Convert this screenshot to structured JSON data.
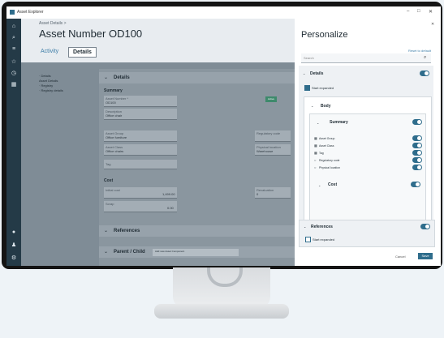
{
  "window": {
    "title": "Asset Explorer",
    "min": "–",
    "max": "□",
    "close": "✕"
  },
  "nav_icons": [
    "home-icon",
    "search-icon",
    "list-icon",
    "star-icon",
    "history-icon",
    "grid-icon",
    "info-icon",
    "user-icon",
    "settings-icon"
  ],
  "header": {
    "breadcrumb": "Asset Details  >",
    "title": "Asset Number OD100",
    "tab_activity": "Activity",
    "tab_details": "Details"
  },
  "tree": [
    "· Details",
    "   Asset Details",
    "· Registry",
    "   · Registry details"
  ],
  "details": {
    "section_title": "Details",
    "summary_label": "Summary",
    "status_badge": "Active",
    "fields": [
      {
        "label": "Asset Number *",
        "value": "OD100"
      },
      {
        "label": "Description",
        "value": "Office chair"
      },
      {
        "label": "Asset Group",
        "value": "Office furniture"
      },
      {
        "label": "Asset Class",
        "value": "Office chairs"
      },
      {
        "label": "Tag",
        "value": ""
      },
      {
        "label": "Regulatory code",
        "value": ""
      },
      {
        "label": "Physical location",
        "value": "Warehouse"
      }
    ],
    "cost_label": "Cost",
    "cost_fields": [
      {
        "label": "Initial cost",
        "value": "1,499.00"
      },
      {
        "label": "Scrap",
        "value": "0.00"
      },
      {
        "label": "Revaluation",
        "value": "0"
      }
    ]
  },
  "references": {
    "title": "References"
  },
  "parent_child": {
    "title": "Parent / Child",
    "button": "Add new Asset Component"
  },
  "personalize": {
    "title": "Personalize",
    "close": "✕",
    "reset": "Reset to default",
    "search_placeholder": "Search",
    "details": "Details",
    "start_expanded": "Start expanded",
    "body": "Body",
    "summary": "Summary",
    "summary_items": [
      "Asset Group",
      "Asset Class",
      "Tag",
      "Regulatory code",
      "Physical location"
    ],
    "cost": "Cost",
    "references": "References",
    "references_start_expanded": "Start expanded",
    "cancel": "Cancel",
    "save": "Save"
  }
}
